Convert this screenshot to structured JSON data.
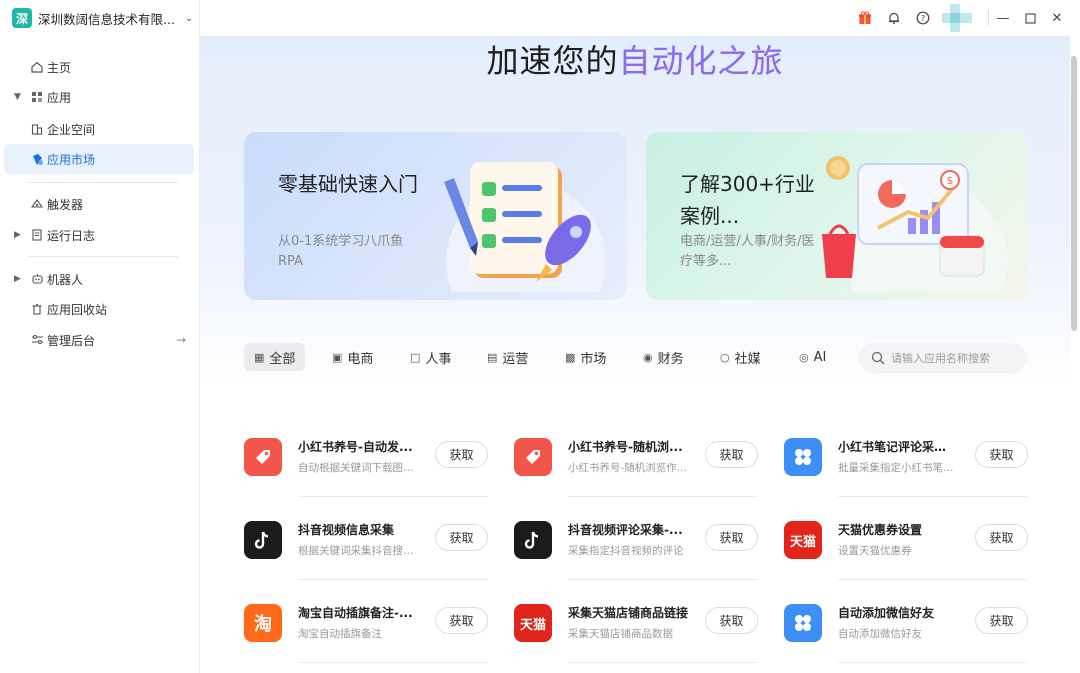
{
  "org": {
    "logo_text": "深",
    "name": "深圳数阔信息技术有限..."
  },
  "sidebar": {
    "items": [
      {
        "label": "主页",
        "icon": "home-icon"
      },
      {
        "label": "应用",
        "icon": "apps-grid-icon"
      },
      {
        "label": "企业空间",
        "icon": "building-icon"
      },
      {
        "label": "应用市场",
        "icon": "market-icon"
      },
      {
        "label": "触发器",
        "icon": "trigger-icon"
      },
      {
        "label": "运行日志",
        "icon": "log-icon"
      },
      {
        "label": "机器人",
        "icon": "robot-icon"
      },
      {
        "label": "应用回收站",
        "icon": "trash-icon"
      },
      {
        "label": "管理后台",
        "icon": "admin-icon"
      }
    ]
  },
  "titlebar": {
    "icons": [
      "gift-icon",
      "bell-icon",
      "help-icon",
      "minimize-icon",
      "maximize-icon",
      "close-icon"
    ]
  },
  "hero": {
    "title_prefix": "加速您的",
    "title_highlight": "自动化之旅"
  },
  "banners": [
    {
      "title": "零基础快速入门",
      "subtitle": "从0-1系统学习八爪鱼RPA"
    },
    {
      "title": "了解300+行业案例...",
      "subtitle": "电商/运营/人事/财务/医疗等多..."
    }
  ],
  "categories": [
    {
      "label": "全部",
      "icon": "grid-icon"
    },
    {
      "label": "电商",
      "icon": "shop-bag-icon"
    },
    {
      "label": "人事",
      "icon": "person-card-icon"
    },
    {
      "label": "运营",
      "icon": "monitor-icon"
    },
    {
      "label": "市场",
      "icon": "chart-icon"
    },
    {
      "label": "财务",
      "icon": "coin-icon"
    },
    {
      "label": "社媒",
      "icon": "chat-icon"
    },
    {
      "label": "AI",
      "icon": "ai-icon"
    }
  ],
  "search": {
    "placeholder": "请输入应用名称搜索"
  },
  "get_label": "获取",
  "apps": [
    {
      "name": "小红书养号-自动发...",
      "desc": "自动根据关键词下载图片...",
      "icon": "xiaohongshu-tag-icon",
      "color": "#f2554a"
    },
    {
      "name": "小红书养号-随机浏...",
      "desc": "小红书养号-随机浏览作...",
      "icon": "xiaohongshu-tag-icon",
      "color": "#f2554a"
    },
    {
      "name": "小红书笔记评论采集...",
      "desc": "批量采集指定小红书笔记...",
      "icon": "four-petal-icon",
      "color": "#3d8ff5"
    },
    {
      "name": "抖音视频信息采集",
      "desc": "根据关键词采集抖音搜索...",
      "icon": "tiktok-icon",
      "color": "#1b1b1b"
    },
    {
      "name": "抖音视频评论采集-...",
      "desc": "采集指定抖音视频的评论",
      "icon": "tiktok-icon",
      "color": "#1b1b1b"
    },
    {
      "name": "天猫优惠券设置",
      "desc": "设置天猫优惠券",
      "icon": "tmall-icon",
      "icon_text": "天猫",
      "color": "#e1251b"
    },
    {
      "name": "淘宝自动插旗备注-...",
      "desc": "淘宝自动插旗备注",
      "icon": "taobao-icon",
      "icon_text": "淘",
      "color": "#ff6a1a"
    },
    {
      "name": "采集天猫店铺商品链接",
      "desc": "采集天猫店铺商品数据",
      "icon": "tmall-icon",
      "icon_text": "天猫",
      "color": "#e1251b"
    },
    {
      "name": "自动添加微信好友",
      "desc": "自动添加微信好友",
      "icon": "four-petal-icon",
      "color": "#3d8ff5"
    }
  ]
}
